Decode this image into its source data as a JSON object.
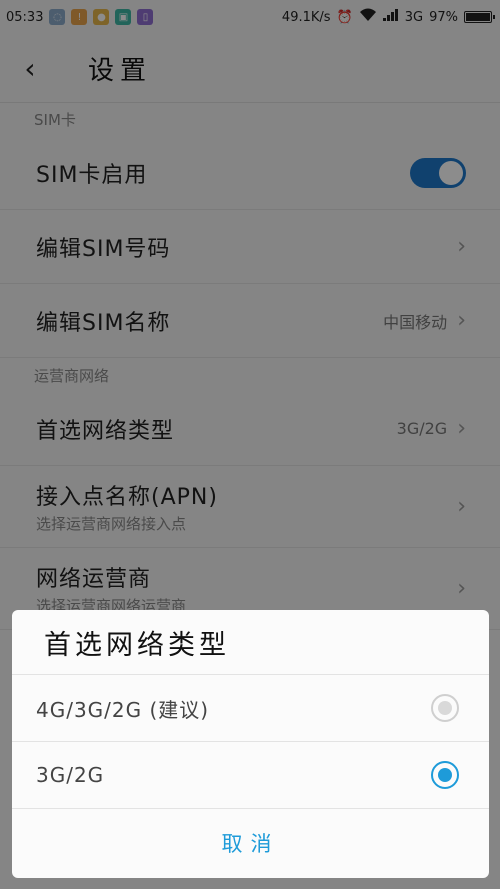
{
  "status_bar": {
    "time": "05:33",
    "net_speed": "49.1K/s",
    "network": "3G",
    "battery": "97%"
  },
  "header": {
    "title": "设置"
  },
  "sections": [
    {
      "header": "SIM卡",
      "rows": [
        {
          "title": "SIM卡启用",
          "toggle_on": true
        },
        {
          "title": "编辑SIM号码"
        },
        {
          "title": "编辑SIM名称",
          "value": "中国移动"
        }
      ]
    },
    {
      "header": "运营商网络",
      "rows": [
        {
          "title": "首选网络类型",
          "value": "3G/2G"
        },
        {
          "title": "接入点名称(APN)",
          "subtitle": "选择运营商网络接入点"
        },
        {
          "title": "网络运营商",
          "subtitle": "选择运营商网络运营商"
        }
      ]
    }
  ],
  "dialog": {
    "title": "首选网络类型",
    "options": [
      {
        "label": "4G/3G/2G (建议)",
        "selected": false
      },
      {
        "label": "3G/2G",
        "selected": true
      }
    ],
    "cancel_label": "取消"
  },
  "colors": {
    "accent": "#1e9bd9",
    "toggle": "#1e77c8"
  }
}
